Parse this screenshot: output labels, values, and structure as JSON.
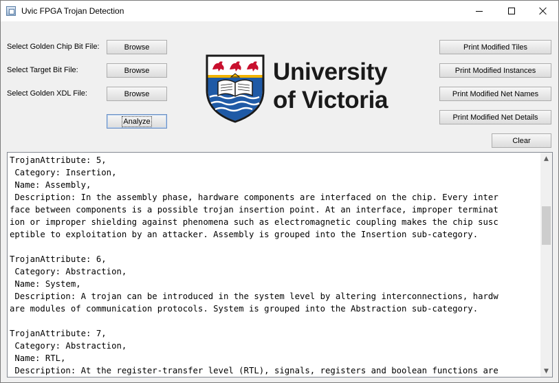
{
  "window": {
    "title": "Uvic FPGA Trojan Detection"
  },
  "form": {
    "golden_chip_label": "Select Golden Chip Bit File:",
    "target_bit_label": "Select Target Bit File:",
    "golden_xdl_label": "Select Golden XDL File:",
    "browse_label": "Browse",
    "analyze_label": "Analyze"
  },
  "actions": {
    "print_tiles": "Print Modified Tiles",
    "print_instances": "Print Modified Instances",
    "print_net_names": "Print Modified Net Names",
    "print_net_details": "Print Modified Net Details",
    "clear": "Clear"
  },
  "logo": {
    "line1": "University",
    "line2": "of Victoria",
    "colors": {
      "red": "#c8102e",
      "blue": "#1f5aa6",
      "gold": "#f2b300",
      "black": "#1a1a1a"
    }
  },
  "output": {
    "lines": [
      "TrojanAttribute: 5,",
      " Category: Insertion,",
      " Name: Assembly,",
      " Description: In the assembly phase, hardware components are interfaced on the chip. Every inter",
      "face between components is a possible trojan insertion point. At an interface, improper terminat",
      "ion or improper shielding against phenomena such as electromagnetic coupling makes the chip susc",
      "eptible to exploitation by an attacker. Assembly is grouped into the Insertion sub-category.",
      "",
      "TrojanAttribute: 6,",
      " Category: Abstraction,",
      " Name: System,",
      " Description: A trojan can be introduced in the system level by altering interconnections, hardw",
      "are modules of communication protocols. System is grouped into the Abstraction sub-category.",
      "",
      "TrojanAttribute: 7,",
      " Category: Abstraction,",
      " Name: RTL,",
      " Description: At the register-transfer level (RTL), signals, registers and boolean functions are"
    ]
  },
  "icons": {
    "app": "window-app-icon",
    "minimize": "minimize-icon",
    "maximize": "maximize-icon",
    "close": "close-icon",
    "scroll_up": "chevron-up-icon",
    "scroll_down": "chevron-down-icon"
  }
}
